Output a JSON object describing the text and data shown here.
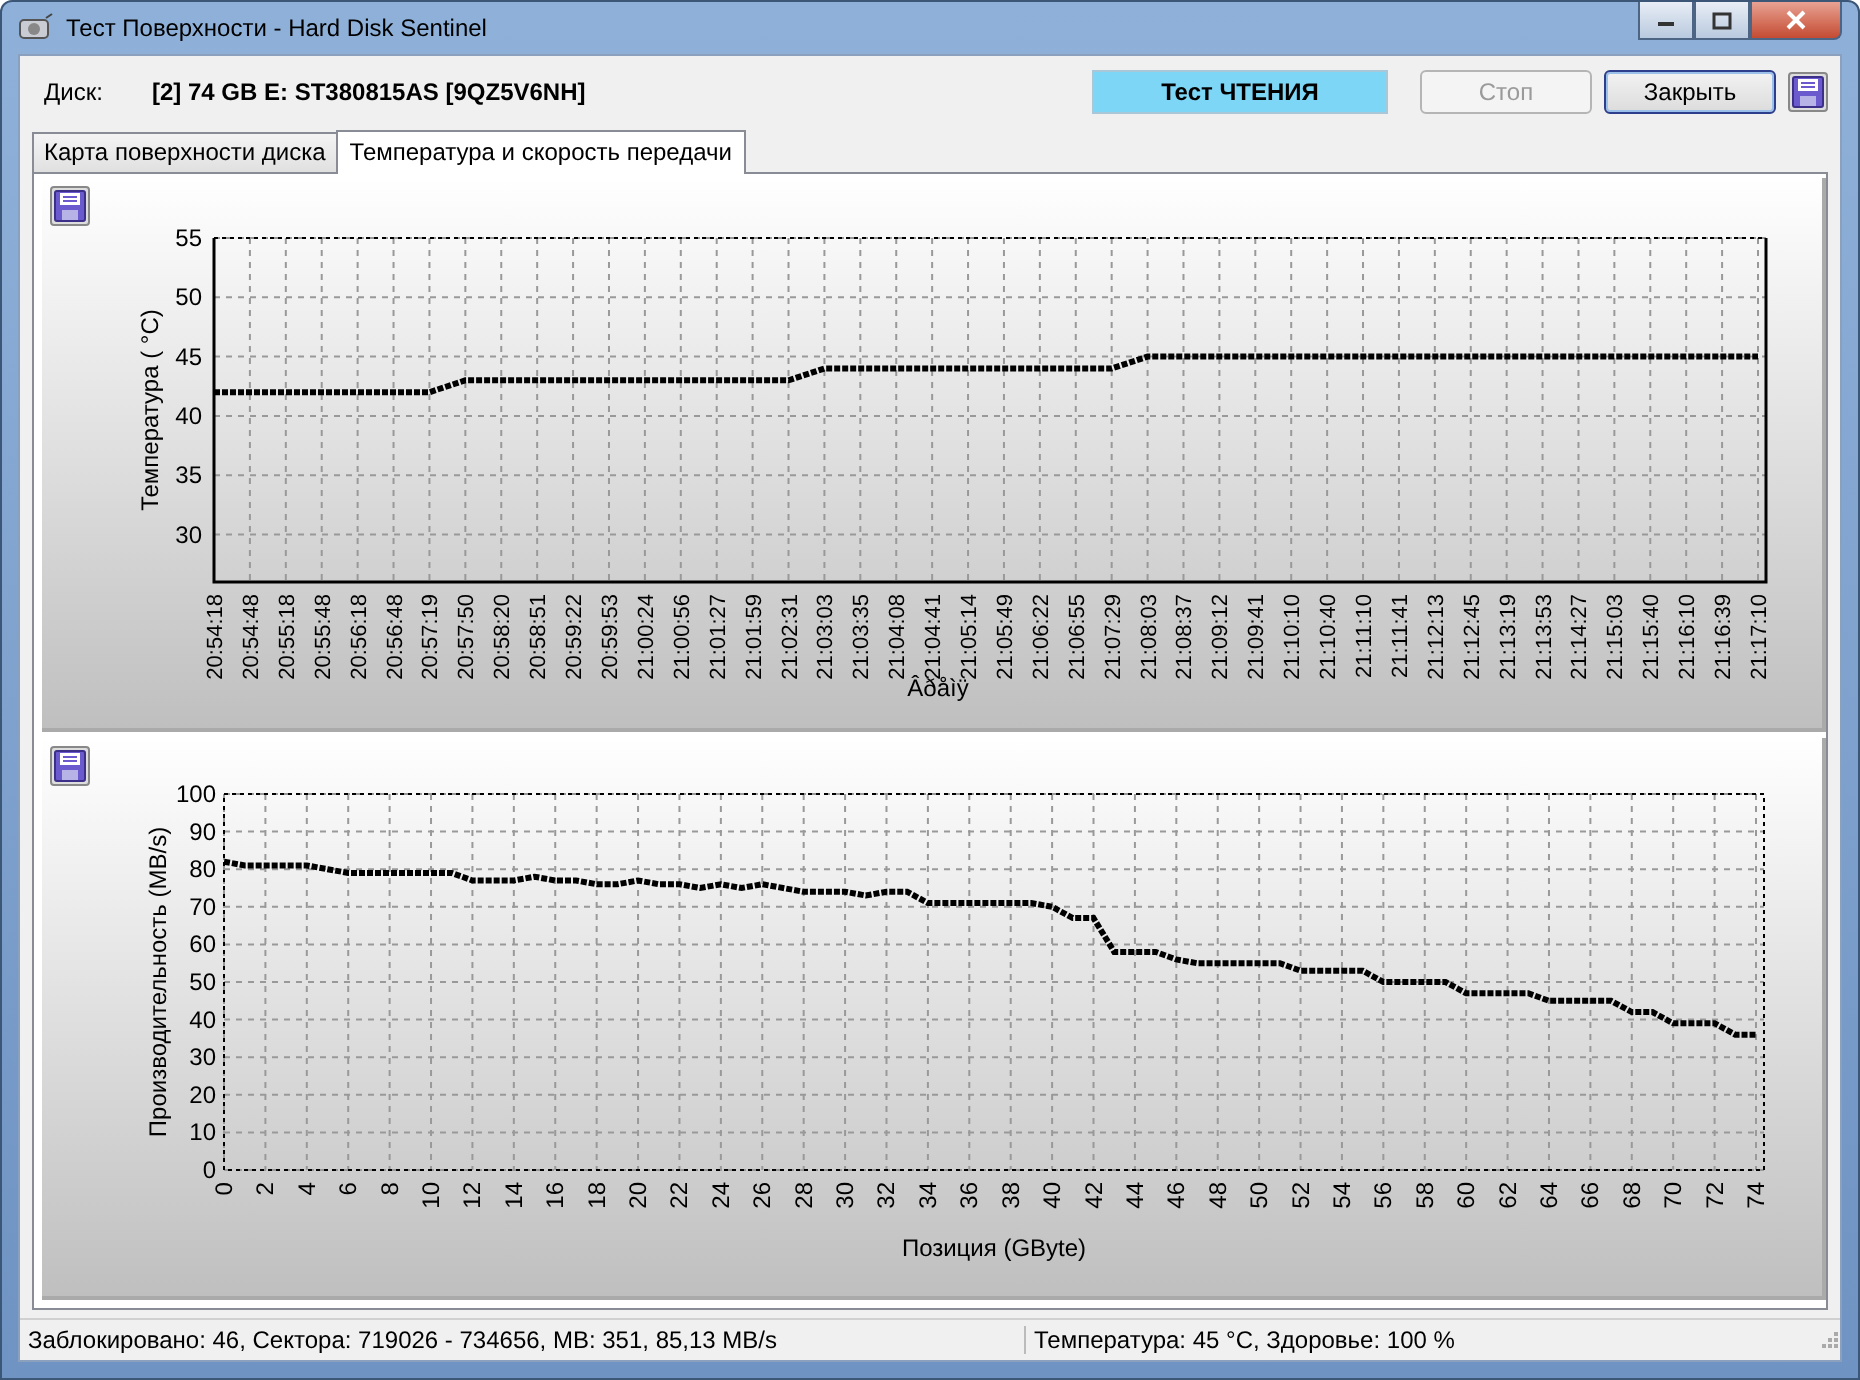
{
  "window": {
    "title": "Тест Поверхности - Hard Disk Sentinel"
  },
  "header": {
    "disk_label": "Диск:",
    "disk_value": "[2] 74 GB E: ST380815AS [9QZ5V6NH]",
    "status": "Тест ЧТЕНИЯ",
    "buttons": [
      {
        "label": "Стоп",
        "disabled": true
      },
      {
        "label": "Закрыть",
        "disabled": false
      }
    ]
  },
  "tabs": [
    {
      "label": "Карта поверхности диска",
      "selected": false
    },
    {
      "label": "Температура и скорость передачи",
      "selected": true
    }
  ],
  "temperature_chart": {
    "chart_data": {
      "type": "line",
      "xlabel": "Âðåìÿ",
      "ylabel": "Температура ( °C)",
      "categories": [
        "20:54:18",
        "20:54:48",
        "20:55:18",
        "20:55:48",
        "20:56:18",
        "20:56:48",
        "20:57:19",
        "20:57:50",
        "20:58:20",
        "20:58:51",
        "20:59:22",
        "20:59:53",
        "21:00:24",
        "21:00:56",
        "21:01:27",
        "21:01:59",
        "21:02:31",
        "21:03:03",
        "21:03:35",
        "21:04:08",
        "21:04:41",
        "21:05:14",
        "21:05:49",
        "21:06:22",
        "21:06:55",
        "21:07:29",
        "21:08:03",
        "21:08:37",
        "21:09:12",
        "21:09:41",
        "21:10:10",
        "21:10:40",
        "21:11:10",
        "21:11:41",
        "21:12:13",
        "21:12:45",
        "21:13:19",
        "21:13:53",
        "21:14:27",
        "21:15:03",
        "21:15:40",
        "21:16:10",
        "21:16:39",
        "21:17:10"
      ],
      "grid": true,
      "series": [
        {
          "color": "#000000",
          "line_style": "dashed",
          "values": [
            42,
            42,
            42,
            42,
            42,
            42,
            42,
            43,
            43,
            43,
            43,
            43,
            43,
            43,
            43,
            43,
            43,
            44,
            44,
            44,
            44,
            44,
            44,
            44,
            44,
            44,
            45,
            45,
            45,
            45,
            45,
            45,
            45,
            45,
            45,
            45,
            45,
            45,
            45,
            45,
            45,
            45,
            45,
            45
          ]
        }
      ],
      "ylim": [
        26,
        55
      ],
      "yticks": [
        30,
        35,
        40,
        45,
        50,
        55
      ]
    }
  },
  "speed_chart": {
    "chart_data": {
      "type": "line",
      "xlabel": "Позиция (GByte)",
      "ylabel": "Производительность (MB/s)",
      "x": [
        0,
        1,
        2,
        3,
        4,
        5,
        6,
        7,
        8,
        9,
        10,
        11,
        12,
        13,
        14,
        15,
        16,
        17,
        18,
        19,
        20,
        21,
        22,
        23,
        24,
        25,
        26,
        27,
        28,
        29,
        30,
        31,
        32,
        33,
        34,
        35,
        36,
        37,
        38,
        39,
        40,
        41,
        42,
        43,
        44,
        45,
        46,
        47,
        48,
        49,
        50,
        51,
        52,
        53,
        54,
        55,
        56,
        57,
        58,
        59,
        60,
        61,
        62,
        63,
        64,
        65,
        66,
        67,
        68,
        69,
        70,
        71,
        72,
        73,
        74
      ],
      "grid": true,
      "series": [
        {
          "color": "#000000",
          "line_style": "dashed",
          "values": [
            82,
            81,
            81,
            81,
            81,
            80,
            79,
            79,
            79,
            79,
            79,
            79,
            77,
            77,
            77,
            78,
            77,
            77,
            76,
            76,
            77,
            76,
            76,
            75,
            76,
            75,
            76,
            75,
            74,
            74,
            74,
            73,
            74,
            74,
            71,
            71,
            71,
            71,
            71,
            71,
            70,
            67,
            67,
            58,
            58,
            58,
            56,
            55,
            55,
            55,
            55,
            55,
            53,
            53,
            53,
            53,
            50,
            50,
            50,
            50,
            47,
            47,
            47,
            47,
            45,
            45,
            45,
            45,
            42,
            42,
            39,
            39,
            39,
            36,
            36
          ]
        }
      ],
      "xlim": [
        0,
        74
      ],
      "ylim": [
        0,
        100
      ],
      "xticks": [
        0,
        2,
        4,
        6,
        8,
        10,
        12,
        14,
        16,
        18,
        20,
        22,
        24,
        26,
        28,
        30,
        32,
        34,
        36,
        38,
        40,
        42,
        44,
        46,
        48,
        50,
        52,
        54,
        56,
        58,
        60,
        62,
        64,
        66,
        68,
        70,
        72,
        74
      ],
      "yticks": [
        0,
        10,
        20,
        30,
        40,
        50,
        60,
        70,
        80,
        90,
        100
      ]
    }
  },
  "status_bar": {
    "left": "Заблокировано: 46, Сектора: 719026 - 734656, MB: 351, 85,13 MB/s",
    "right": "Температура: 45  °C,  Здоровье: 100 %"
  }
}
